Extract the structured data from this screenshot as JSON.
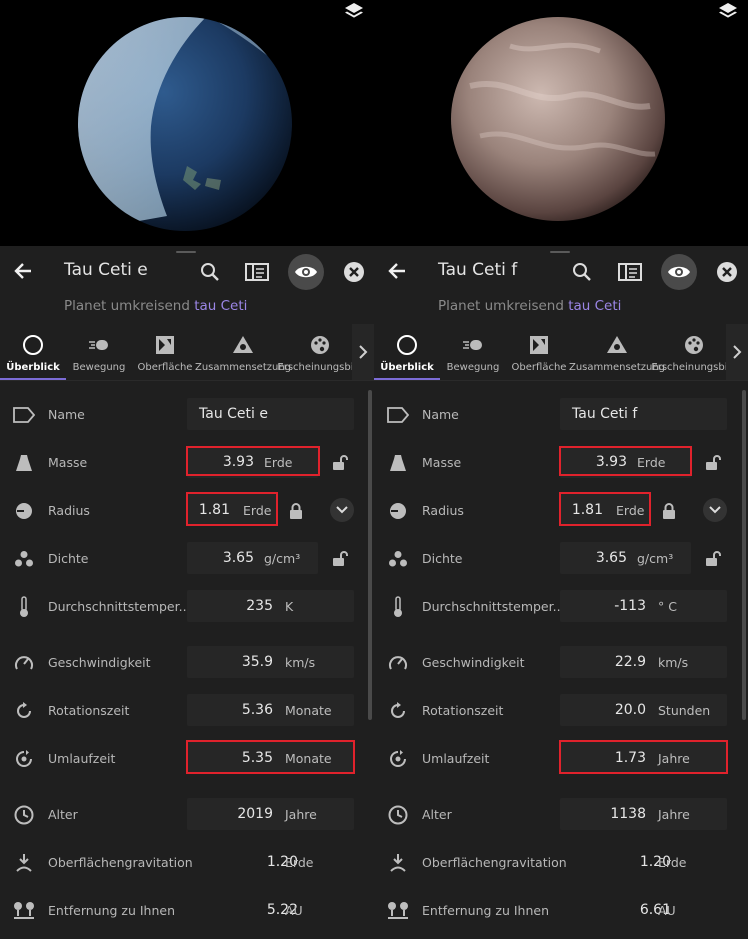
{
  "panels": [
    {
      "id": "left",
      "planet": {
        "color_base": "#1d3a66",
        "color_highlight": "#7fa6c9"
      },
      "title": "Tau Ceti e",
      "subtitle_prefix": "Planet umkreisend",
      "subtitle_link": "tau Ceti",
      "tabs": [
        "Überblick",
        "Bewegung",
        "Oberfläche",
        "Zusammensetzung",
        "Erscheinungsbild"
      ],
      "active_tab": "Überblick",
      "rows": {
        "name": {
          "label": "Name",
          "value": "Tau Ceti e"
        },
        "mass": {
          "label": "Masse",
          "value": "3.93",
          "unit": "Erde"
        },
        "radius": {
          "label": "Radius",
          "value": "1.81",
          "unit": "Erde"
        },
        "density": {
          "label": "Dichte",
          "value": "3.65",
          "unit": "g/cm³"
        },
        "temperature": {
          "label": "Durchschnittstemper...",
          "value": "235",
          "unit": "K"
        },
        "velocity": {
          "label": "Geschwindigkeit",
          "value": "35.9",
          "unit": "km/s"
        },
        "rotation": {
          "label": "Rotationszeit",
          "value": "5.36",
          "unit": "Monate"
        },
        "orbit": {
          "label": "Umlaufzeit",
          "value": "5.35",
          "unit": "Monate"
        },
        "age": {
          "label": "Alter",
          "value": "2019",
          "unit": "Jahre"
        },
        "gravity": {
          "label": "Oberflächengravitation",
          "value": "1.20",
          "unit": "Erde"
        },
        "distance": {
          "label": "Entfernung zu Ihnen",
          "value": "5.22",
          "unit": "AU"
        }
      }
    },
    {
      "id": "right",
      "planet": {
        "color_base": "#6e5650",
        "color_highlight": "#c8b2a8"
      },
      "title": "Tau Ceti f",
      "subtitle_prefix": "Planet umkreisend",
      "subtitle_link": "tau Ceti",
      "tabs": [
        "Überblick",
        "Bewegung",
        "Oberfläche",
        "Zusammensetzung",
        "Erscheinungsbild"
      ],
      "active_tab": "Überblick",
      "rows": {
        "name": {
          "label": "Name",
          "value": "Tau Ceti f"
        },
        "mass": {
          "label": "Masse",
          "value": "3.93",
          "unit": "Erde"
        },
        "radius": {
          "label": "Radius",
          "value": "1.81",
          "unit": "Erde"
        },
        "density": {
          "label": "Dichte",
          "value": "3.65",
          "unit": "g/cm³"
        },
        "temperature": {
          "label": "Durchschnittstemper...",
          "value": "-113",
          "unit": "° C"
        },
        "velocity": {
          "label": "Geschwindigkeit",
          "value": "22.9",
          "unit": "km/s"
        },
        "rotation": {
          "label": "Rotationszeit",
          "value": "20.0",
          "unit": "Stunden"
        },
        "orbit": {
          "label": "Umlaufzeit",
          "value": "1.73",
          "unit": "Jahre"
        },
        "age": {
          "label": "Alter",
          "value": "1138",
          "unit": "Jahre"
        },
        "gravity": {
          "label": "Oberflächengravitation",
          "value": "1.20",
          "unit": "Erde"
        },
        "distance": {
          "label": "Entfernung zu Ihnen",
          "value": "6.61",
          "unit": "AU"
        }
      }
    }
  ],
  "colors": {
    "accent": "#7c6cd6",
    "highlight_box": "#e0222c",
    "link": "#9b86e6"
  },
  "icons": [
    "layers-icon",
    "back-arrow-icon",
    "search-icon",
    "details-panel-icon",
    "eye-icon",
    "close-icon",
    "chevron-right-icon",
    "chevron-down-icon",
    "lock-icon",
    "unlock-icon"
  ]
}
